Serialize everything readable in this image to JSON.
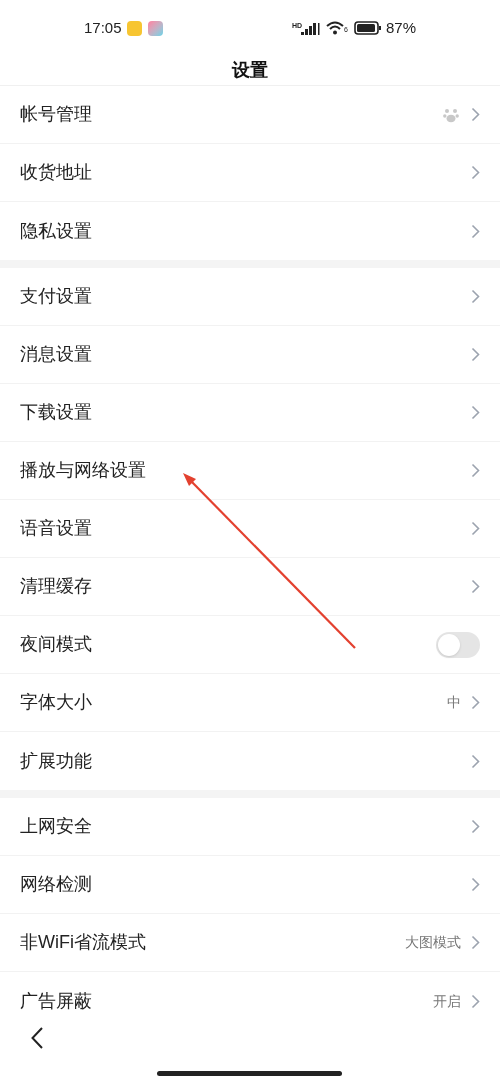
{
  "status_bar": {
    "time": "17:05",
    "network": "HD",
    "wifi_badge": "6",
    "battery": "87%"
  },
  "title": "设置",
  "groups": [
    {
      "items": [
        {
          "kind": "link",
          "label": "帐号管理",
          "avatar": true
        },
        {
          "kind": "link",
          "label": "收货地址"
        },
        {
          "kind": "link",
          "label": "隐私设置"
        }
      ]
    },
    {
      "items": [
        {
          "kind": "link",
          "label": "支付设置"
        },
        {
          "kind": "link",
          "label": "消息设置"
        },
        {
          "kind": "link",
          "label": "下载设置"
        },
        {
          "kind": "link",
          "label": "播放与网络设置"
        },
        {
          "kind": "link",
          "label": "语音设置"
        },
        {
          "kind": "link",
          "label": "清理缓存"
        },
        {
          "kind": "toggle",
          "label": "夜间模式",
          "on": false
        },
        {
          "kind": "link",
          "label": "字体大小",
          "value": "中"
        },
        {
          "kind": "link",
          "label": "扩展功能"
        }
      ]
    },
    {
      "items": [
        {
          "kind": "link",
          "label": "上网安全"
        },
        {
          "kind": "link",
          "label": "网络检测"
        },
        {
          "kind": "link",
          "label": "非WiFi省流模式",
          "value": "大图模式"
        },
        {
          "kind": "link",
          "label": "广告屏蔽",
          "value": "开启"
        }
      ]
    }
  ]
}
